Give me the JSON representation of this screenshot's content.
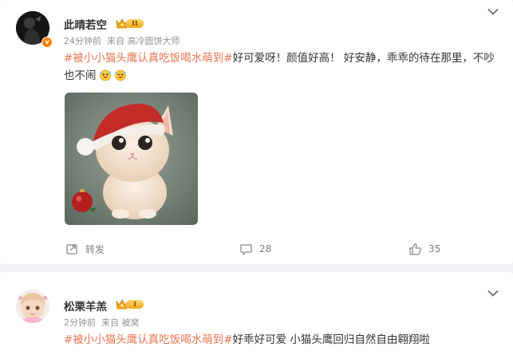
{
  "posts": [
    {
      "user": {
        "name": "此晴若空",
        "level": "II",
        "verified_mark": "v"
      },
      "time": "24分钟前",
      "source": "来自 高冷圆饼大师",
      "topic": "#被小小猫头鹰认真吃饭喝水萌到#",
      "text": "好可爱呀！颜值好高！ 好安静，乖乖的待在那里，不吵也不闹",
      "emoji_icons": [
        "laughing-emoji-icon",
        "laughing-emoji-icon"
      ],
      "image": "christmas-hat-kitten-image",
      "actions": {
        "repost_label": "转发",
        "comment_count": "28",
        "like_count": "35"
      }
    },
    {
      "user": {
        "name": "松栗羊羔",
        "level": "I"
      },
      "time": "2分钟前",
      "source": "来自 被窝",
      "topic": "#被小小猫头鹰认真吃饭喝水萌到#",
      "text": "好乖好可爱 小猫头鹰回归自然自由翱翔啦"
    }
  ],
  "colors": {
    "topic": "#eb7350",
    "meta": "#939393",
    "background": "#f1f2f5",
    "card": "#ffffff",
    "verified": "#ff8200"
  },
  "icons": [
    "chevron-down-icon",
    "repost-icon",
    "comment-icon",
    "like-icon",
    "crown-icon"
  ]
}
